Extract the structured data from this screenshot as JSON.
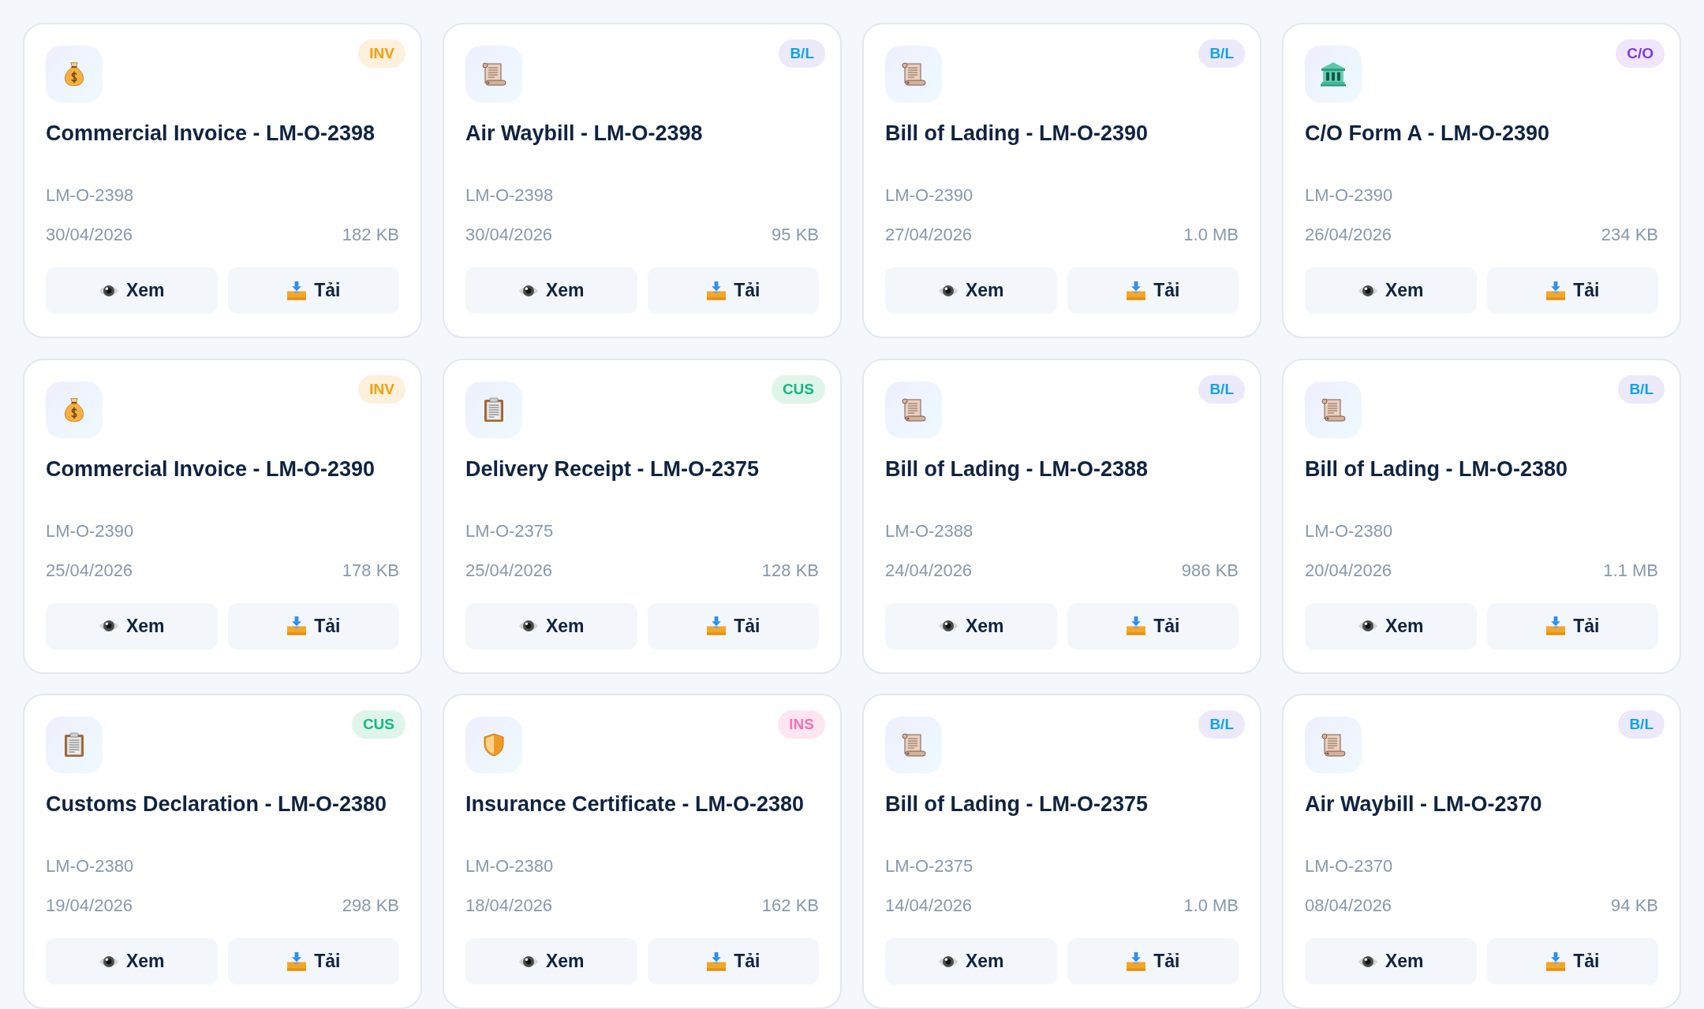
{
  "documents": [
    {
      "kind": "invoice",
      "badge": "INV",
      "title": "Commercial Invoice - LM-O-2398",
      "order": "LM-O-2398",
      "date": "30/04/2026",
      "size": "182 KB",
      "actions": [
        {
          "kind": "view",
          "label": "Xem"
        },
        {
          "kind": "download",
          "label": "Tải"
        }
      ]
    },
    {
      "kind": "bill",
      "badge": "B/L",
      "title": "Air Waybill - LM-O-2398",
      "order": "LM-O-2398",
      "date": "30/04/2026",
      "size": "95 KB",
      "actions": [
        {
          "kind": "view",
          "label": "Xem"
        },
        {
          "kind": "download",
          "label": "Tải"
        }
      ]
    },
    {
      "kind": "bill",
      "badge": "B/L",
      "title": "Bill of Lading - LM-O-2390",
      "order": "LM-O-2390",
      "date": "27/04/2026",
      "size": "1.0 MB",
      "actions": [
        {
          "kind": "view",
          "label": "Xem"
        },
        {
          "kind": "download",
          "label": "Tải"
        }
      ]
    },
    {
      "kind": "origin",
      "badge": "C/O",
      "title": "C/O Form A - LM-O-2390",
      "order": "LM-O-2390",
      "date": "26/04/2026",
      "size": "234 KB",
      "actions": [
        {
          "kind": "view",
          "label": "Xem"
        },
        {
          "kind": "download",
          "label": "Tải"
        }
      ]
    },
    {
      "kind": "invoice",
      "badge": "INV",
      "title": "Commercial Invoice - LM-O-2390",
      "order": "LM-O-2390",
      "date": "25/04/2026",
      "size": "178 KB",
      "actions": [
        {
          "kind": "view",
          "label": "Xem"
        },
        {
          "kind": "download",
          "label": "Tải"
        }
      ]
    },
    {
      "kind": "customs",
      "badge": "CUS",
      "title": "Delivery Receipt - LM-O-2375",
      "order": "LM-O-2375",
      "date": "25/04/2026",
      "size": "128 KB",
      "actions": [
        {
          "kind": "view",
          "label": "Xem"
        },
        {
          "kind": "download",
          "label": "Tải"
        }
      ]
    },
    {
      "kind": "bill",
      "badge": "B/L",
      "title": "Bill of Lading - LM-O-2388",
      "order": "LM-O-2388",
      "date": "24/04/2026",
      "size": "986 KB",
      "actions": [
        {
          "kind": "view",
          "label": "Xem"
        },
        {
          "kind": "download",
          "label": "Tải"
        }
      ]
    },
    {
      "kind": "bill",
      "badge": "B/L",
      "title": "Bill of Lading - LM-O-2380",
      "order": "LM-O-2380",
      "date": "20/04/2026",
      "size": "1.1 MB",
      "actions": [
        {
          "kind": "view",
          "label": "Xem"
        },
        {
          "kind": "download",
          "label": "Tải"
        }
      ]
    },
    {
      "kind": "customs",
      "badge": "CUS",
      "title": "Customs Declaration - LM-O-2380",
      "order": "LM-O-2380",
      "date": "19/04/2026",
      "size": "298 KB",
      "actions": [
        {
          "kind": "view",
          "label": "Xem"
        },
        {
          "kind": "download",
          "label": "Tải"
        }
      ]
    },
    {
      "kind": "insurance",
      "badge": "INS",
      "title": "Insurance Certificate - LM-O-2380",
      "order": "LM-O-2380",
      "date": "18/04/2026",
      "size": "162 KB",
      "actions": [
        {
          "kind": "view",
          "label": "Xem"
        },
        {
          "kind": "download",
          "label": "Tải"
        }
      ]
    },
    {
      "kind": "bill",
      "badge": "B/L",
      "title": "Bill of Lading - LM-O-2375",
      "order": "LM-O-2375",
      "date": "14/04/2026",
      "size": "1.0 MB",
      "actions": [
        {
          "kind": "view",
          "label": "Xem"
        },
        {
          "kind": "download",
          "label": "Tải"
        }
      ]
    },
    {
      "kind": "bill",
      "badge": "B/L",
      "title": "Air Waybill - LM-O-2370",
      "order": "LM-O-2370",
      "date": "08/04/2026",
      "size": "94 KB",
      "actions": [
        {
          "kind": "view",
          "label": "Xem"
        },
        {
          "kind": "download",
          "label": "Tải"
        }
      ]
    }
  ]
}
